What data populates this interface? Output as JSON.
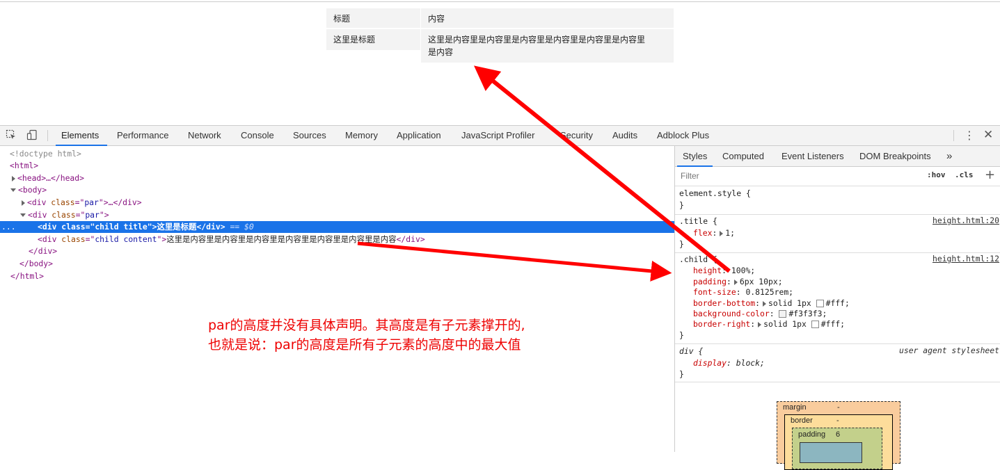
{
  "page": {
    "table": {
      "header_title": "标题",
      "header_content": "内容",
      "row_title": "这里是标题",
      "row_content_line1": "这里是内容里是内容里是内容里是内容里是内容里是内容里",
      "row_content_line2": "是内容"
    }
  },
  "devtools": {
    "tabs": [
      "Elements",
      "Performance",
      "Network",
      "Console",
      "Sources",
      "Memory",
      "Application",
      "JavaScript Profiler",
      "Security",
      "Audits",
      "Adblock Plus"
    ],
    "active_tab": "Elements",
    "dom": {
      "doctype": "<!doctype html>",
      "html_open": "<html>",
      "head_collapsed": "<head>…</head>",
      "body_open": "<body>",
      "par1_tag": "div",
      "par1_attr": "class",
      "par1_val": "par",
      "par2_tag": "div",
      "par2_attr": "class",
      "par2_val": "par",
      "child1_attr_val": "child title",
      "child1_text": "这里是标题",
      "child1_marker": " == $0",
      "child2_attr_val": "child content",
      "child2_text": "这里是内容里是内容里是内容里是内容里是内容里是内容里是内容",
      "div_close": "</div>",
      "body_close": "</body>",
      "html_close": "</html>",
      "ellipsis": "..."
    },
    "styles_panel": {
      "tabs": [
        "Styles",
        "Computed",
        "Event Listeners",
        "DOM Breakpoints"
      ],
      "more": "»",
      "filter_placeholder": "Filter",
      "hov": ":hov",
      "cls": ".cls",
      "plus": "+",
      "element_style_open": "element.style {",
      "close_brace": "}",
      "title_rule": {
        "selector": ".title {",
        "source": "height.html:20",
        "prop": "flex",
        "value": "1;"
      },
      "child_rule": {
        "selector": ".child {",
        "source": "height.html:12",
        "props": [
          {
            "name": "height",
            "value": "100%;"
          },
          {
            "name": "padding",
            "value": "6px 10px;"
          },
          {
            "name": "font-size",
            "value": "0.8125rem;"
          },
          {
            "name": "border-bottom",
            "value": "solid 1px",
            "color": "#fff;"
          },
          {
            "name": "background-color",
            "value": "",
            "color": "#f3f3f3;"
          },
          {
            "name": "border-right",
            "value": "solid 1px",
            "color": "#fff;"
          }
        ]
      },
      "ua_rule": {
        "selector": "div {",
        "source": "user agent stylesheet",
        "prop": "display",
        "value": "block;"
      },
      "box_model": {
        "margin_label": "margin",
        "margin_value": "-",
        "border_label": "border",
        "border_value": "-",
        "padding_label": "padding",
        "padding_value": "6"
      }
    }
  },
  "annotation": {
    "line1": "par的高度并没有具体声明。其高度是有子元素撑开的,",
    "line2": "也就是说：par的高度是所有子元素的高度中的最大值",
    "color": "#ee0000"
  }
}
